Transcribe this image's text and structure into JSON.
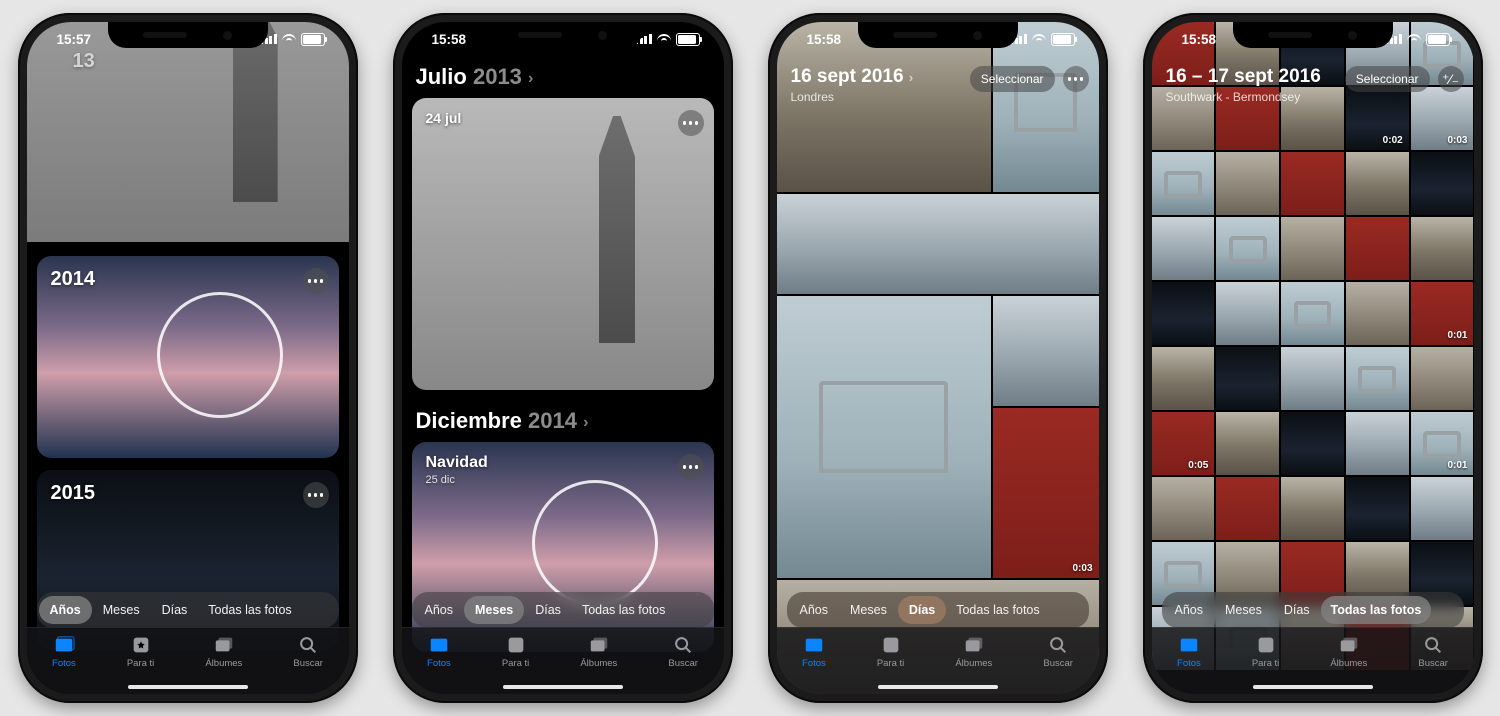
{
  "statusbar": {
    "times": [
      "15:57",
      "15:58",
      "15:58",
      "15:58"
    ]
  },
  "segments": {
    "years": "Años",
    "months": "Meses",
    "days": "Días",
    "all": "Todas las fotos"
  },
  "tabbar": {
    "photos": "Fotos",
    "for_you": "Para ti",
    "albums": "Álbumes",
    "search": "Buscar"
  },
  "buttons": {
    "select": "Seleccionar",
    "zoom": "⁺⁄₋"
  },
  "phone1": {
    "year_top_overlay": "13",
    "years": [
      "2014",
      "2015"
    ]
  },
  "phone2": {
    "month1_prefix": "Julio",
    "month1_year": "2013",
    "month1_sub": "24 jul",
    "month2_prefix": "Diciembre",
    "month2_year": "2014",
    "card2_title": "Navidad",
    "card2_sub": "25 dic"
  },
  "phone3": {
    "title": "16 sept 2016",
    "subtitle": "Londres",
    "durations": [
      "0:03"
    ]
  },
  "phone4": {
    "title": "16 – 17 sept 2016",
    "subtitle": "Southwark - Bermondsey",
    "durations": [
      "0:02",
      "0:03",
      "0:01",
      "0:05",
      "0:01"
    ]
  }
}
